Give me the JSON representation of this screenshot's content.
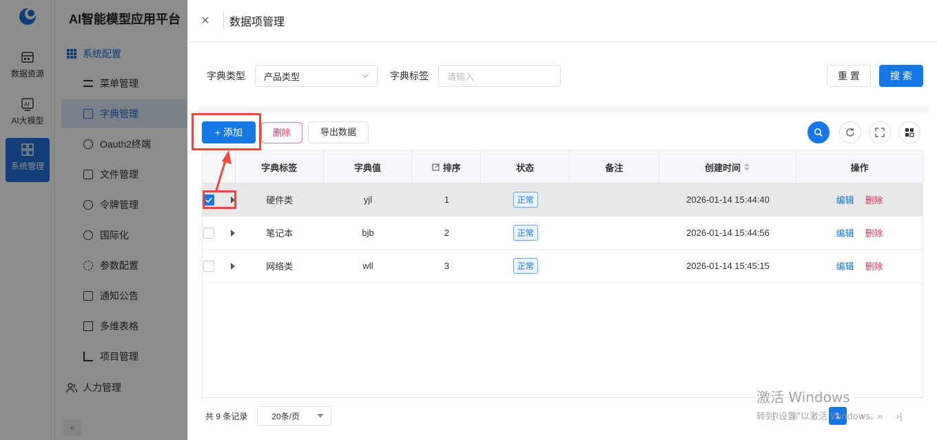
{
  "app": {
    "title": "AI智能模型应用平台",
    "iconbar": [
      {
        "label": "数据资源",
        "icon": "database-icon"
      },
      {
        "label": "AI大模型",
        "icon": "ai-model-icon"
      },
      {
        "label": "系统管理",
        "icon": "system-icon"
      }
    ],
    "menu_group": "系统配置",
    "menu": [
      {
        "label": "菜单管理",
        "icon": "menu-list-icon"
      },
      {
        "label": "字典管理",
        "icon": "dictionary-icon"
      },
      {
        "label": "Oauth2终端",
        "icon": "oauth-icon"
      },
      {
        "label": "文件管理",
        "icon": "file-icon"
      },
      {
        "label": "令牌管理",
        "icon": "token-icon"
      },
      {
        "label": "国际化",
        "icon": "globe-icon"
      },
      {
        "label": "参数配置",
        "icon": "param-icon"
      },
      {
        "label": "通知公告",
        "icon": "notice-icon"
      },
      {
        "label": "多维表格",
        "icon": "table-icon"
      },
      {
        "label": "项目管理",
        "icon": "project-icon"
      }
    ],
    "menu_hr": "人力管理",
    "collapse_label": "«"
  },
  "drawer": {
    "title": "数据项管理",
    "close_label": "×",
    "filter": {
      "type_label": "字典类型",
      "type_value": "产品类型",
      "tag_label": "字典标签",
      "tag_placeholder": "请输入",
      "reset_label": "重 置",
      "search_label": "搜 索"
    },
    "toolbar": {
      "add_label": "+ 添加",
      "delete_label": "删除",
      "export_label": "导出数据"
    },
    "table": {
      "headers": [
        "字典标签",
        "字典值",
        "排序",
        "状态",
        "备注",
        "创建时间",
        "操作"
      ],
      "rows": [
        {
          "label": "硬件类",
          "value": "yjl",
          "sort": "1",
          "status": "正常",
          "remark": "",
          "created": "2026-01-14 15:44:40",
          "edit": "编辑",
          "del": "删除",
          "checked": true
        },
        {
          "label": "笔记本",
          "value": "bjb",
          "sort": "2",
          "status": "正常",
          "remark": "",
          "created": "2026-01-14 15:44:56",
          "edit": "编辑",
          "del": "删除",
          "checked": false
        },
        {
          "label": "网络类",
          "value": "wll",
          "sort": "3",
          "status": "正常",
          "remark": "",
          "created": "2026-01-14 15:45:15",
          "edit": "编辑",
          "del": "删除",
          "checked": false
        }
      ]
    },
    "pager": {
      "total": "共 9 条记录",
      "page_size": "20条/页",
      "current": "1"
    }
  },
  "watermark": {
    "line1": "激活 Windows",
    "line2": "转到\"设置\"以激活 Windows。"
  },
  "colors": {
    "primary": "#1677e6",
    "danger": "#e8345c",
    "highlight": "#e84a3c"
  }
}
